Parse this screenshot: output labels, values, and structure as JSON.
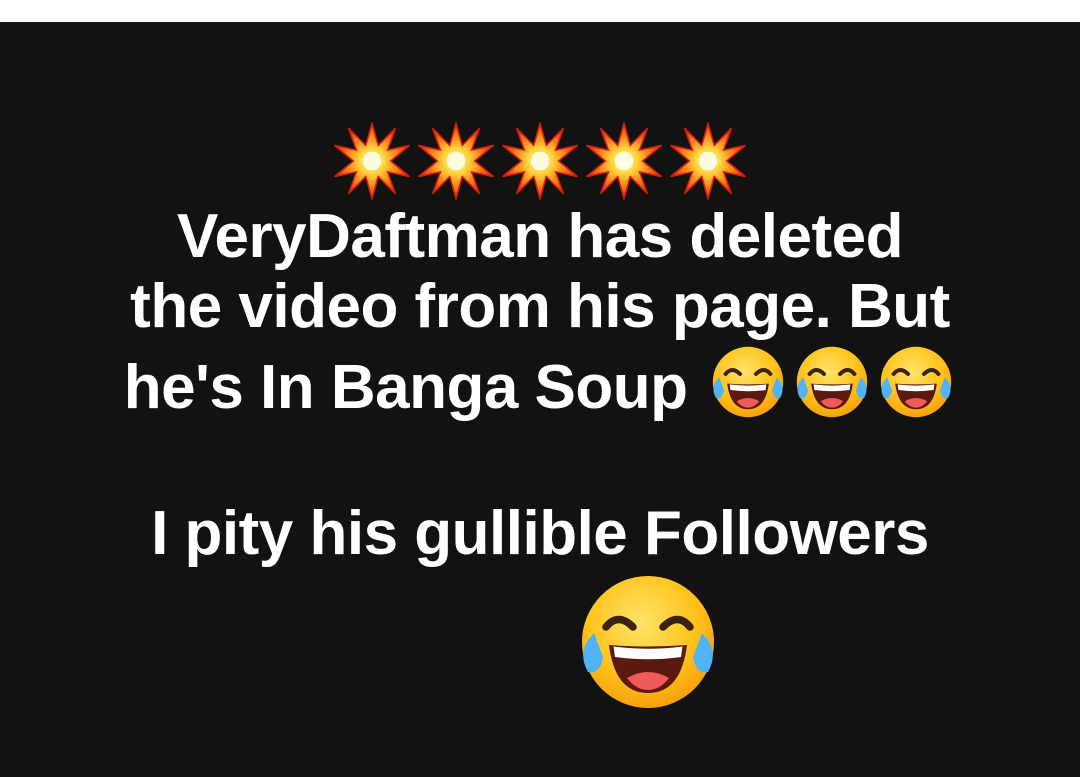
{
  "post": {
    "line1": "VeryDaftman has deleted",
    "line2": "the video from his page. But",
    "line3": "he's In Banga Soup",
    "line4": "I pity his gullible Followers"
  },
  "icons": {
    "burst": "collision-emoji",
    "laugh": "face-with-tears-of-joy-emoji"
  },
  "colors": {
    "background": "#121212",
    "text": "#ffffff"
  }
}
